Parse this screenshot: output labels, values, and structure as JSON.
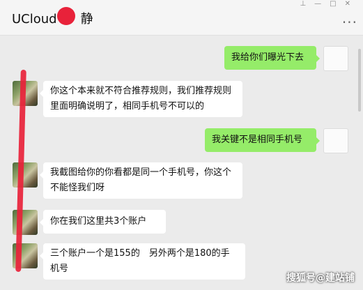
{
  "window": {
    "title": "UCloud",
    "title_suffix": "静"
  },
  "messages": [
    {
      "sender": "self",
      "text": "我给你们曝光下去"
    },
    {
      "sender": "other",
      "text": "你这个本来就不符合推荐规则，我们推荐规则里面明确说明了，相同手机号不可以的"
    },
    {
      "sender": "self",
      "text": "我关键不是相同手机号"
    },
    {
      "sender": "other",
      "text": "我截图给你的你看都是同一个手机号，你这个不能怪我们呀"
    },
    {
      "sender": "other",
      "text": "你在我们这里共3个账户"
    },
    {
      "sender": "other",
      "text": "三个账户一个是155的　另外两个是180的手机号"
    }
  ],
  "watermark": "搜狐号@建站铺",
  "colors": {
    "self_bubble": "#95ec69",
    "other_bubble": "#ffffff",
    "background": "#ebebeb",
    "redaction": "#e8223a"
  },
  "icons": [
    "pin-icon",
    "minimize-icon",
    "maximize-icon",
    "close-icon",
    "more-icon"
  ]
}
